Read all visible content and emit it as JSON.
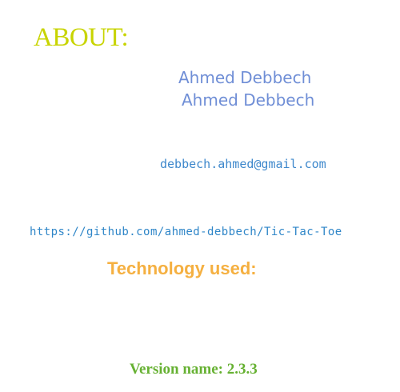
{
  "about": {
    "title": "ABOUT:",
    "authors": [
      "Ahmed Debbech",
      "Ahmed Debbech"
    ],
    "email": "debbech.ahmed@gmail.com",
    "github_url": "https://github.com/ahmed-debbech/Tic-Tac-Toe",
    "technology_label": "Technology used:",
    "version_label": "Version name: 2.3.3"
  },
  "colors": {
    "title": "#c8d400",
    "author": "#6f8ed6",
    "link": "#3e88cc",
    "technology": "#f5b041",
    "version": "#66b132"
  }
}
